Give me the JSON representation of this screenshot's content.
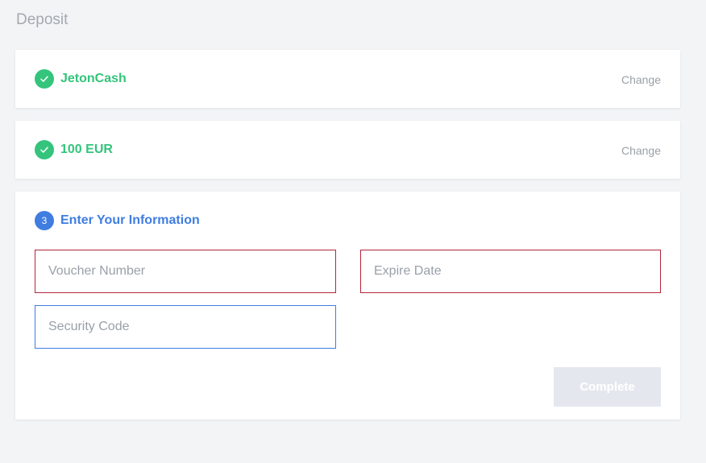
{
  "page": {
    "title": "Deposit"
  },
  "steps": {
    "step1": {
      "label": "JetonCash",
      "status": "complete",
      "change_label": "Change"
    },
    "step2": {
      "label": "100 EUR",
      "status": "complete",
      "change_label": "Change"
    },
    "step3": {
      "number": "3",
      "label": "Enter Your Information",
      "status": "active",
      "fields": {
        "voucher_placeholder": "Voucher Number",
        "expire_placeholder": "Expire Date",
        "security_placeholder": "Security Code"
      },
      "complete_label": "Complete"
    }
  },
  "colors": {
    "success": "#34c47c",
    "accent": "#3f7de0",
    "error_border": "#b3263a",
    "disabled_button": "#e4e8ee"
  },
  "icons": {
    "done": "check-icon"
  }
}
